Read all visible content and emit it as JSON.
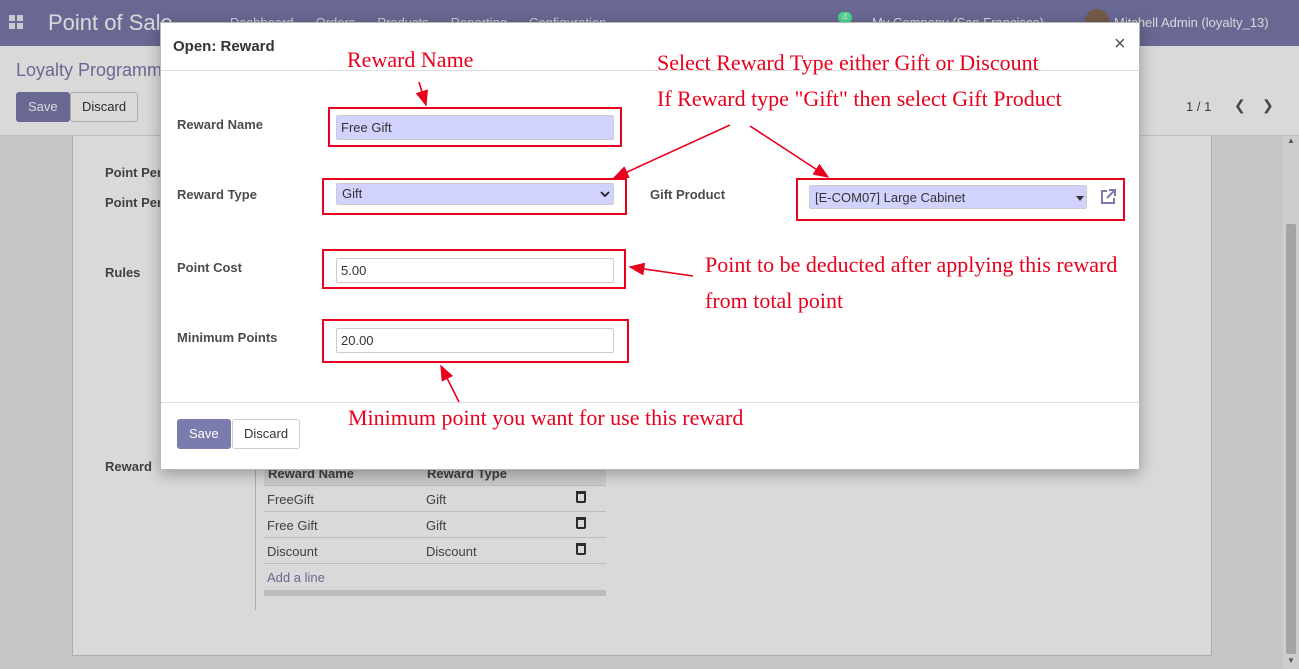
{
  "navbar": {
    "app_name": "Point of Sale",
    "menu": [
      "Dashboard",
      "Orders",
      "Products",
      "Reporting",
      "Configuration"
    ],
    "chat_count": "4",
    "company": "My Company (San Francisco)",
    "user": "Mitchell Admin (loyalty_13)"
  },
  "control_panel": {
    "breadcrumb": "Loyalty Programme",
    "save_label": "Save",
    "discard_label": "Discard",
    "pager": "1 / 1"
  },
  "background_form": {
    "labels": [
      "Point Per",
      "Point Per",
      "Rules",
      "Reward"
    ],
    "reward_table": {
      "columns": [
        "Reward Name",
        "Reward Type"
      ],
      "rows": [
        {
          "name": "FreeGift",
          "type": "Gift"
        },
        {
          "name": "Free Gift",
          "type": "Gift"
        },
        {
          "name": "Discount",
          "type": "Discount"
        }
      ],
      "add_line": "Add a line"
    }
  },
  "modal": {
    "title": "Open: Reward",
    "close_symbol": "×",
    "fields": {
      "reward_name_label": "Reward Name",
      "reward_name_value": "Free Gift",
      "reward_type_label": "Reward Type",
      "reward_type_value": "Gift",
      "gift_product_label": "Gift Product",
      "gift_product_value": "[E-COM07] Large Cabinet",
      "point_cost_label": "Point Cost",
      "point_cost_value": "5.00",
      "minimum_points_label": "Minimum Points",
      "minimum_points_value": "20.00"
    },
    "save_label": "Save",
    "discard_label": "Discard"
  },
  "annotations": {
    "reward_name": "Reward Name",
    "reward_type_line1": "Select Reward Type either Gift or Discount",
    "reward_type_line2": "If Reward type \"Gift\" then select Gift Product",
    "point_cost_line1": "Point to be deducted after applying this reward",
    "point_cost_line2": "from total point",
    "minimum_points": "Minimum point you want for use this reward"
  },
  "colors": {
    "navbar": "#7c7bad",
    "primary": "#7c7bad",
    "required_field": "#d2d2ff",
    "annotation": "#e8001c"
  },
  "icons": [
    "apps-icon",
    "close-icon",
    "external-link-icon",
    "trash-icon",
    "chevron-left-icon",
    "chevron-right-icon",
    "caret-down-icon"
  ]
}
